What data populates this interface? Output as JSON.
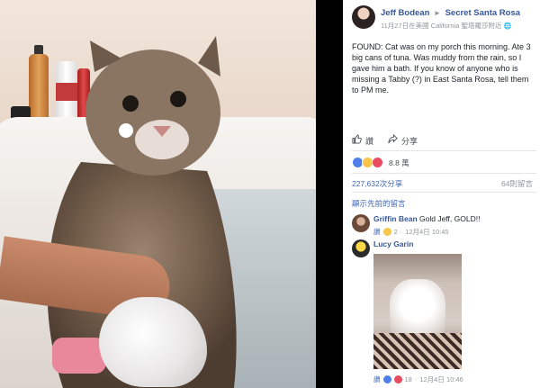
{
  "post": {
    "author": "Jeff Bodean",
    "arrow": "►",
    "target": "Secret Santa Rosa",
    "timestamp": "11月27日在美國 California 聖塔羅莎附近",
    "text": "FOUND: Cat was on my porch this morning. Ate 3 big cans of tuna. Was muddy from the rain, so I gave him a bath. If you know of anyone who is missing a Tabby (?) in East Santa Rosa, tell them to PM me."
  },
  "actions": {
    "like_label": "讚",
    "share_label": "分享"
  },
  "reactions": {
    "count": "8.8 萬"
  },
  "stats": {
    "shares": "227,632次分享",
    "comments": "64則留言"
  },
  "comments_section": {
    "previous_label": "顯示先前的留言",
    "items": [
      {
        "name": "Griffin Bean",
        "text": "Gold Jeff, GOLD!!",
        "like_label": "讚",
        "reaction_count": "2",
        "time": "12月4日 10:45"
      },
      {
        "name": "Lucy Garin",
        "text": "",
        "like_label": "讚",
        "reaction_count": "18",
        "time": "12月4日 10:46"
      }
    ]
  },
  "colors": {
    "link": "#365899",
    "accent": "#4267b2",
    "meta": "#90949c",
    "like_blue": "#4f7ee8",
    "haha_yellow": "#f7c64a",
    "love_red": "#e84a5f"
  }
}
